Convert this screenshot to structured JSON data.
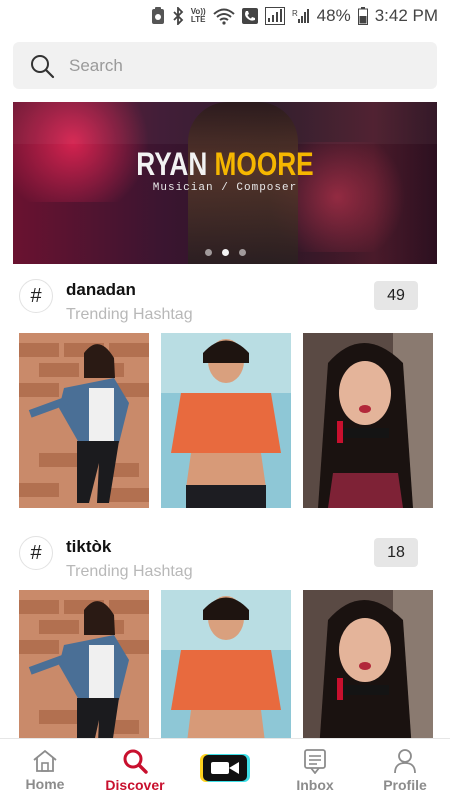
{
  "status_bar": {
    "battery": "48%",
    "time": "3:42 PM",
    "volte": "Vo)) LTE",
    "icons": [
      "screenshot-icon",
      "bluetooth-icon",
      "volte-icon",
      "wifi-call-icon",
      "phone-icon",
      "sim-signal-icon",
      "signal-r-icon",
      "battery-icon"
    ]
  },
  "search": {
    "placeholder": "Search"
  },
  "banner": {
    "title_first": "RYAN",
    "title_last": "MOORE",
    "subtitle": "Musician / Composer",
    "active_slide": 2,
    "slide_count": 3,
    "colors": {
      "title": "#f2f2f2",
      "accent": "#f5b700"
    }
  },
  "hashtags": [
    {
      "name": "danadan",
      "subtitle": "Trending Hashtag",
      "count": "49"
    },
    {
      "name": "tiktòk",
      "subtitle": "Trending Hashtag",
      "count": "18"
    }
  ],
  "hash_symbol": "#",
  "nav": {
    "items": [
      {
        "label": "Home",
        "icon": "home-icon"
      },
      {
        "label": "Discover",
        "icon": "search-icon"
      },
      {
        "label": "",
        "icon": "camera-record-icon"
      },
      {
        "label": "Inbox",
        "icon": "inbox-icon"
      },
      {
        "label": "Profile",
        "icon": "profile-icon"
      }
    ],
    "active": "Discover",
    "accent": "#c8102e"
  }
}
